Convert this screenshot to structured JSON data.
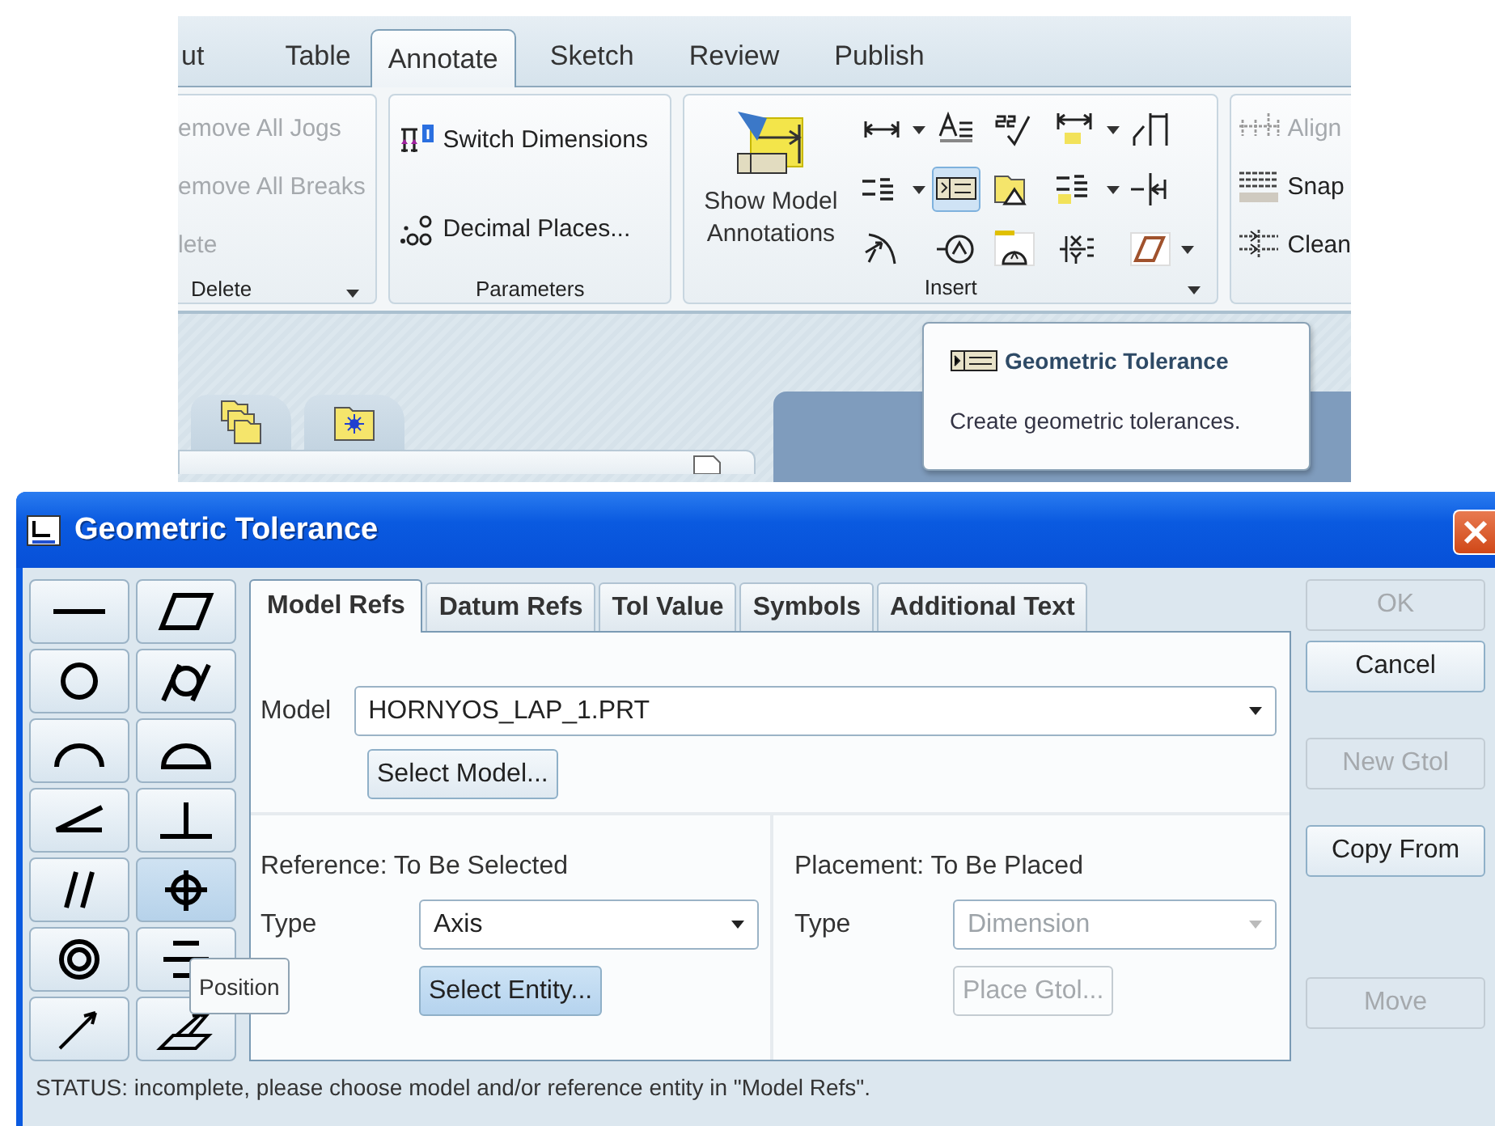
{
  "ribbon": {
    "tabs": [
      {
        "label": "ut",
        "selected": false
      },
      {
        "label": "Table",
        "selected": false
      },
      {
        "label": "Annotate",
        "selected": true
      },
      {
        "label": "Sketch",
        "selected": false
      },
      {
        "label": "Review",
        "selected": false
      },
      {
        "label": "Publish",
        "selected": false
      }
    ],
    "delete_group": {
      "label": "Delete",
      "items": [
        {
          "label": "emove All Jogs",
          "disabled": true
        },
        {
          "label": "emove All Breaks",
          "disabled": true
        },
        {
          "label": "lete",
          "disabled": true
        }
      ]
    },
    "parameters_group": {
      "label": "Parameters",
      "items": [
        {
          "label": "Switch Dimensions",
          "kind": "switch"
        },
        {
          "label": "Decimal Places...",
          "kind": "decimal"
        }
      ]
    },
    "insert_group": {
      "label": "Insert",
      "big_button": {
        "label": "Show Model Annotations"
      },
      "tools": [
        {
          "kind": "dimension",
          "menu": true,
          "selected": false
        },
        {
          "kind": "note",
          "menu": false,
          "selected": false
        },
        {
          "kind": "checkmark",
          "menu": false,
          "selected": false
        },
        {
          "kind": "ordinate",
          "menu": true,
          "selected": false
        },
        {
          "kind": "bracket",
          "menu": false,
          "selected": false
        },
        {
          "kind": "stack",
          "menu": true,
          "selected": false
        },
        {
          "kind": "frame",
          "menu": false,
          "selected": true
        },
        {
          "kind": "folder",
          "menu": false,
          "selected": false
        },
        {
          "kind": "stack2",
          "menu": true,
          "selected": false
        },
        {
          "kind": "jog",
          "menu": false,
          "selected": false
        },
        {
          "kind": "curve",
          "menu": false,
          "selected": false
        },
        {
          "kind": "target",
          "menu": false,
          "selected": false
        },
        {
          "kind": "datum",
          "menu": false,
          "selected": false
        },
        {
          "kind": "table",
          "menu": false,
          "selected": false
        },
        {
          "kind": "parallelogram",
          "menu": true,
          "selected": false
        }
      ]
    },
    "arrange_group": {
      "items": [
        {
          "label": "Align",
          "disabled": true
        },
        {
          "label": "Snap",
          "disabled": false
        },
        {
          "label": "Clean",
          "disabled": false
        }
      ]
    }
  },
  "tooltip": {
    "title": "Geometric Tolerance",
    "text": "Create geometric tolerances."
  },
  "dialog": {
    "title": "Geometric Tolerance",
    "symbols": [
      {
        "kind": "straightness",
        "selected": false
      },
      {
        "kind": "flatness",
        "selected": false
      },
      {
        "kind": "circularity",
        "selected": false
      },
      {
        "kind": "cylindricity",
        "selected": false
      },
      {
        "kind": "profile-line",
        "selected": false
      },
      {
        "kind": "profile-surface",
        "selected": false
      },
      {
        "kind": "angularity",
        "selected": false
      },
      {
        "kind": "perpendicularity",
        "selected": false
      },
      {
        "kind": "parallelism",
        "selected": false
      },
      {
        "kind": "position",
        "selected": true
      },
      {
        "kind": "concentricity",
        "selected": false
      },
      {
        "kind": "symmetry",
        "selected": false
      },
      {
        "kind": "circular-runout",
        "selected": false
      },
      {
        "kind": "total-runout",
        "selected": false
      }
    ],
    "tabs": [
      {
        "label": "Model Refs",
        "selected": true
      },
      {
        "label": "Datum Refs",
        "selected": false
      },
      {
        "label": "Tol Value",
        "selected": false
      },
      {
        "label": "Symbols",
        "selected": false
      },
      {
        "label": "Additional Text",
        "selected": false
      }
    ],
    "model": {
      "label": "Model",
      "value": "HORNYOS_LAP_1.PRT",
      "button": "Select Model..."
    },
    "reference": {
      "heading": "Reference: To Be Selected",
      "type_label": "Type",
      "type_value": "Axis",
      "button": "Select Entity...",
      "button_highlighted": true,
      "disabled": false
    },
    "placement": {
      "heading": "Placement: To Be Placed",
      "type_label": "Type",
      "type_value": "Dimension",
      "button": "Place Gtol...",
      "disabled": true
    },
    "buttons": [
      {
        "label": "OK",
        "disabled": true
      },
      {
        "label": "Cancel",
        "disabled": false
      },
      {
        "label": "New Gtol",
        "disabled": true
      },
      {
        "label": "Copy From",
        "disabled": false
      },
      {
        "label": "Move",
        "disabled": true
      }
    ],
    "symbol_tooltip": "Position",
    "status": "STATUS: incomplete, please choose model and/or reference entity in \"Model Refs\"."
  }
}
